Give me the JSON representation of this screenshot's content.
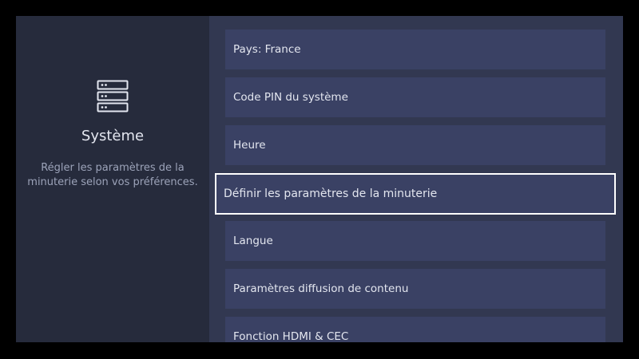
{
  "panel": {
    "icon": "server-stack-icon",
    "title": "Système",
    "description": "Régler les paramètres de la minuterie selon vos préférences."
  },
  "menu": {
    "items": [
      {
        "label": "Pays: France"
      },
      {
        "label": "Code PIN du système"
      },
      {
        "label": "Heure"
      },
      {
        "label": "Définir les paramètres de la minuterie",
        "selected": true
      },
      {
        "label": "Langue"
      },
      {
        "label": "Paramètres diffusion de contenu"
      },
      {
        "label": "Fonction HDMI & CEC"
      }
    ]
  },
  "colors": {
    "background": "#000000",
    "panel_left": "#262b3c",
    "panel_right": "#323851",
    "item": "#3a4164",
    "selected_border": "#ffffff",
    "text": "#e3e6ef",
    "text_muted": "#9ca3b9"
  }
}
